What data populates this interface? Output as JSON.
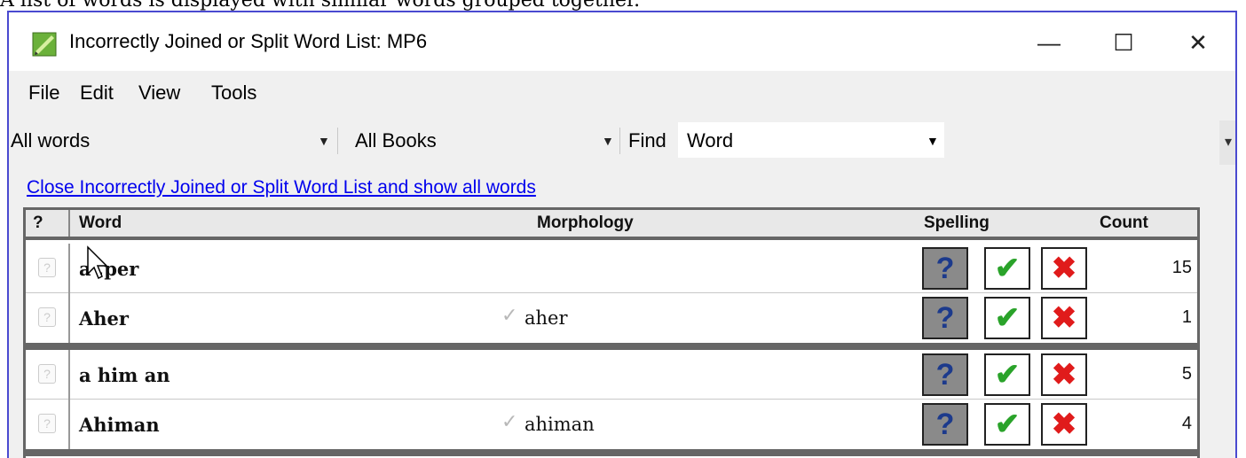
{
  "caption": "A list of words is displayed with similar words grouped together.",
  "window": {
    "title": "Incorrectly Joined or Split Word List: MP6",
    "controls": {
      "minimize": "—",
      "maximize": "☐",
      "close": "✕"
    }
  },
  "menu": [
    "File",
    "Edit",
    "View",
    "Tools"
  ],
  "toolbar": {
    "filter_value": "All words",
    "books_value": "All Books",
    "find_label": "Find",
    "find_field_value": "Word"
  },
  "link_text": "Close Incorrectly Joined or Split Word List and show all words",
  "table": {
    "headers": {
      "q": "?",
      "word": "Word",
      "morphology": "Morphology",
      "spelling": "Spelling",
      "count": "Count"
    },
    "rows": [
      {
        "word": "a ,per",
        "morphology": "",
        "count": "15"
      },
      {
        "word": "Aher",
        "morphology": "aher",
        "count": "1"
      },
      {
        "word": "a him an",
        "morphology": "",
        "count": "5"
      },
      {
        "word": "Ahiman",
        "morphology": "ahiman",
        "count": "4"
      }
    ]
  },
  "icons": {
    "question": "?",
    "check": "✔",
    "cross": "✖",
    "morph_check": "✓"
  },
  "colors": {
    "link": "#0000ee",
    "check_green": "#2aa32a",
    "cross_red": "#e01b1b",
    "question_bg": "#8a8a8a"
  }
}
